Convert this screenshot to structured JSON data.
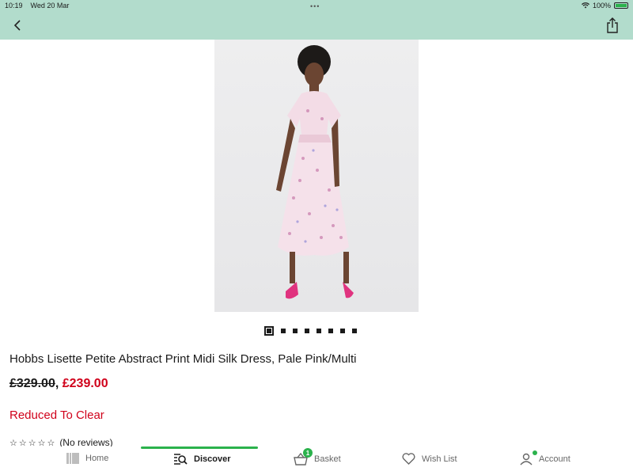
{
  "status_bar": {
    "time": "10:19",
    "date": "Wed 20 Mar",
    "battery": "100%"
  },
  "nav": {
    "back_icon": "chevron-left-icon",
    "share_icon": "share-icon"
  },
  "product": {
    "title": "Hobbs Lisette Petite Abstract Print Midi Silk Dress, Pale Pink/Multi",
    "old_price": "£329.00",
    "separator": ",",
    "new_price": "£239.00",
    "promo": "Reduced To Clear",
    "stars": "☆☆☆☆☆",
    "reviews": "(No reviews)",
    "image_count": 8,
    "image_index": 1
  },
  "tabs": [
    {
      "label": "Home",
      "icon": "home-icon"
    },
    {
      "label": "Discover",
      "icon": "discover-icon",
      "active": true
    },
    {
      "label": "Basket",
      "icon": "basket-icon",
      "badge": "1"
    },
    {
      "label": "Wish List",
      "icon": "heart-icon"
    },
    {
      "label": "Account",
      "icon": "account-icon"
    }
  ],
  "colors": {
    "header_bg": "#b2dccc",
    "accent": "#2bb24c",
    "price_red": "#d0021b"
  }
}
